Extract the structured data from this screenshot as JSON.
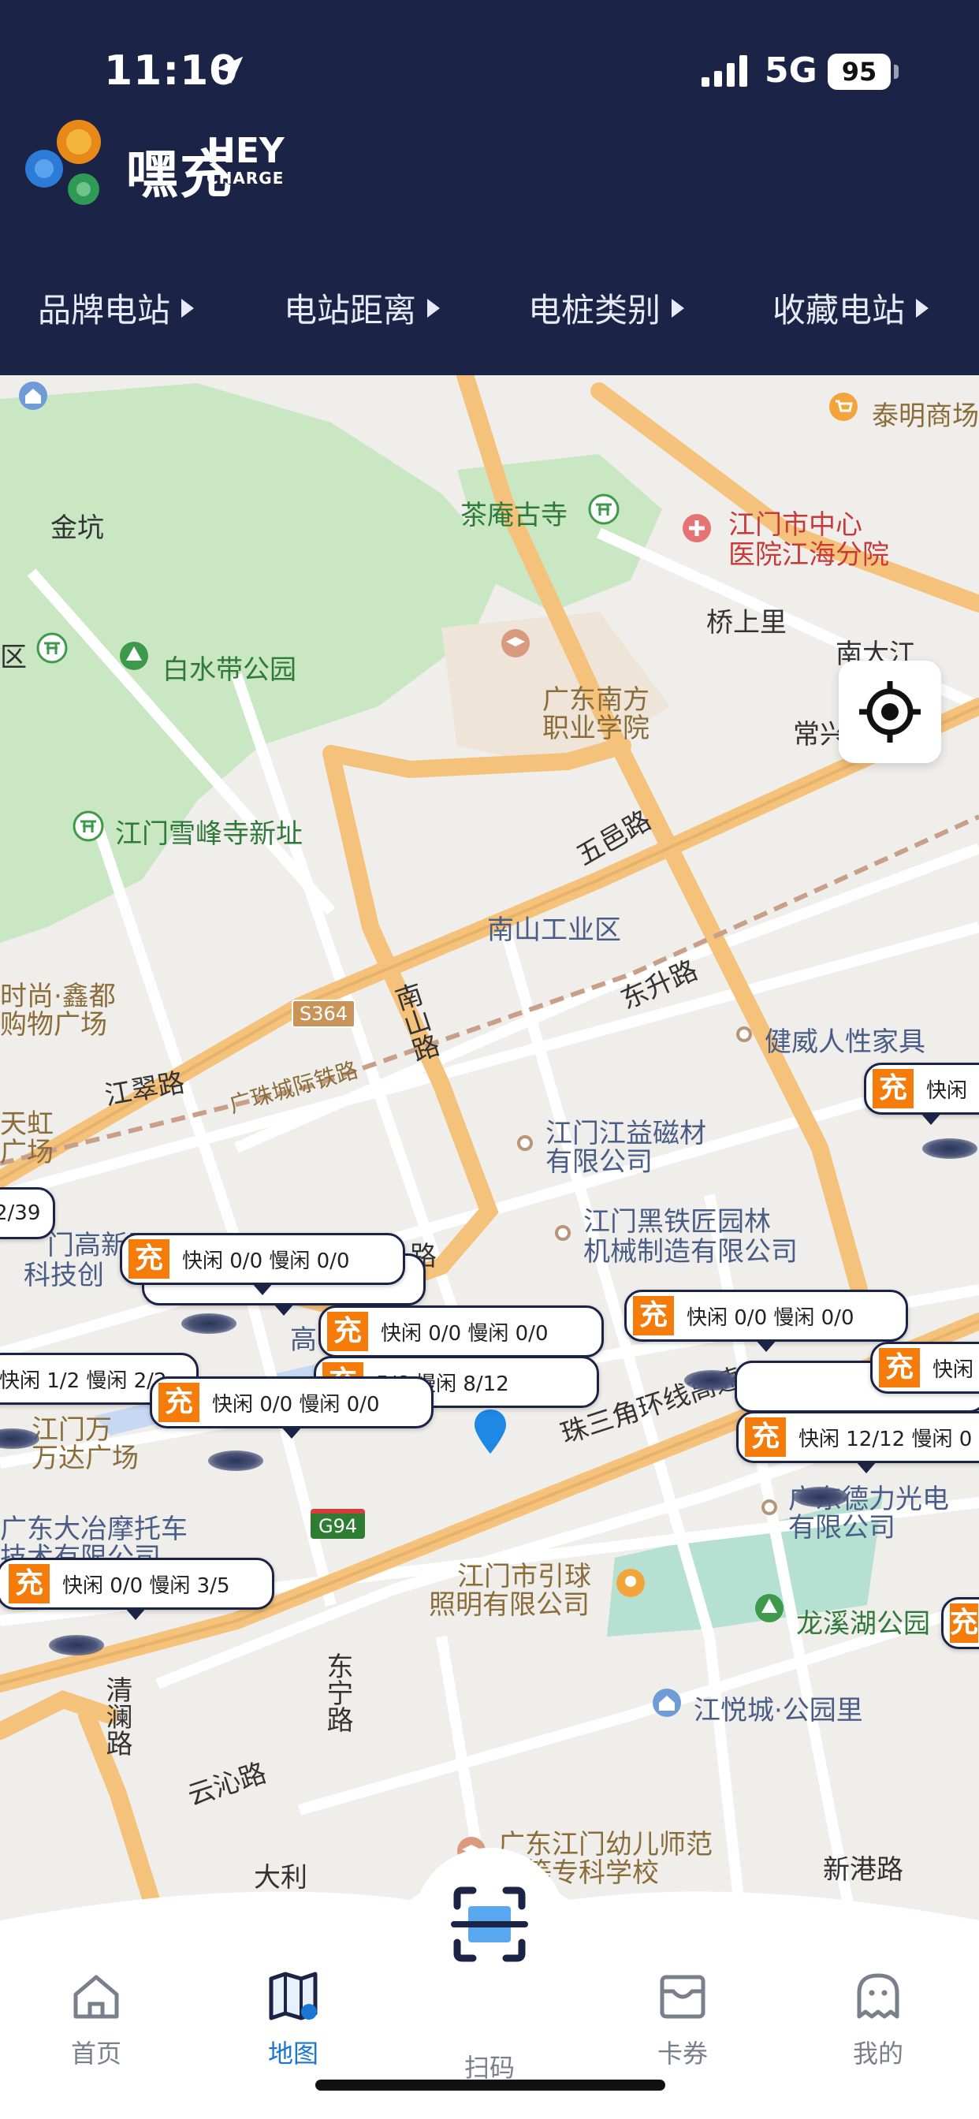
{
  "status_bar": {
    "time": "11:10",
    "network": "5G",
    "battery": "95"
  },
  "brand": {
    "name_cn": "嘿充",
    "name_en": "HEY",
    "name_en_sub": "CHARGE"
  },
  "filters": [
    {
      "label": "品牌电站"
    },
    {
      "label": "电站距离"
    },
    {
      "label": "电桩类别"
    },
    {
      "label": "收藏电站"
    }
  ],
  "map": {
    "labels": {
      "jinkeng": "金坑",
      "chaan": "茶庵古寺",
      "jiangmen_hospital_1": "江门市中心",
      "jiangmen_hospital_2": "医院江海分院",
      "taiming": "泰明商场",
      "qiaoshangli": "桥上里",
      "nandajiang": "南大江",
      "changxing": "常兴",
      "qu": "区",
      "baishuidai": "白水带公园",
      "gdnf_1": "广东南方",
      "gdnf_2": "职业学院",
      "xuefeng": "江门雪峰寺新址",
      "wuyi_road": "五邑路",
      "nanshan_ind": "南山工业区",
      "dongsheng_road": "东升路",
      "jianwei": "健威人性家具",
      "cunshang_1": "时尚·鑫都",
      "cunshang_2": "购物广场",
      "s364": "S364",
      "nanshan_road": "南山路",
      "jiangcui_road": "江翠路",
      "guangzhu_rail": "广珠城际铁路",
      "tianhong_1": "天虹",
      "tianhong_2": "广场",
      "jiangyi_1": "江门江益磁材",
      "jiangyi_2": "有限公司",
      "heitie_1": "江门黑铁匠园林",
      "heitie_2": "机械制造有限公司",
      "gaoxin_1": "门高新区",
      "gaoxin_2": "科技创",
      "gao": "高",
      "lu": "路",
      "wanda_1": "江门万",
      "wanda_2": "万达广场",
      "zhusanjiao": "珠三角环线高速",
      "dezhi_1": "广东德力光电",
      "dezhi_2": "有限公司",
      "daye_1": "广东大冶摩托车",
      "daye_2": "技术有限公司",
      "g94": "G94",
      "yinqiu_1": "江门市引球",
      "yinqiu_2": "照明有限公司",
      "longxi": "龙溪湖公园",
      "qinglan_road": "清澜路",
      "dongning_road": "东宁路",
      "jiangyue": "江悦城·公园里",
      "yunqin_road": "云沁路",
      "kindergarten_1": "广东江门幼儿师范",
      "kindergarten_2": "高等专科学校",
      "xingang_road": "新港路",
      "dali": "大利"
    },
    "stations": [
      {
        "badge": "充",
        "text": "快闲"
      },
      {
        "badge": "",
        "text": "2/39"
      },
      {
        "badge": "充",
        "text": "快闲 0/0  慢闲 0/0"
      },
      {
        "badge": "充",
        "text": "快闲 0/0  慢闲 0/0"
      },
      {
        "badge": "充",
        "text": "快闲 0/0  慢闲 0/0"
      },
      {
        "badge": "充",
        "text": "5/6  慢闲 8/12"
      },
      {
        "badge": "",
        "text": "快闲 1/2  慢闲 2/2"
      },
      {
        "badge": "充",
        "text": "快闲 0/0  慢闲 0/0"
      },
      {
        "badge": "充",
        "text": "快闲"
      },
      {
        "badge": "充",
        "text": "快闲 12/12  慢闲 0"
      },
      {
        "badge": "充",
        "text": "快闲 0/0  慢闲 3/5"
      },
      {
        "badge": "充",
        "text": ""
      }
    ]
  },
  "tabs": [
    {
      "label": "首页"
    },
    {
      "label": "地图"
    },
    {
      "label": "扫码"
    },
    {
      "label": "卡券"
    },
    {
      "label": "我的"
    }
  ],
  "colors": {
    "header_bg": "#1b2346",
    "accent_orange": "#f57c0a",
    "active_tab": "#1976d2",
    "road_major": "#f4c27a",
    "park_green": "#c8e6c0"
  }
}
